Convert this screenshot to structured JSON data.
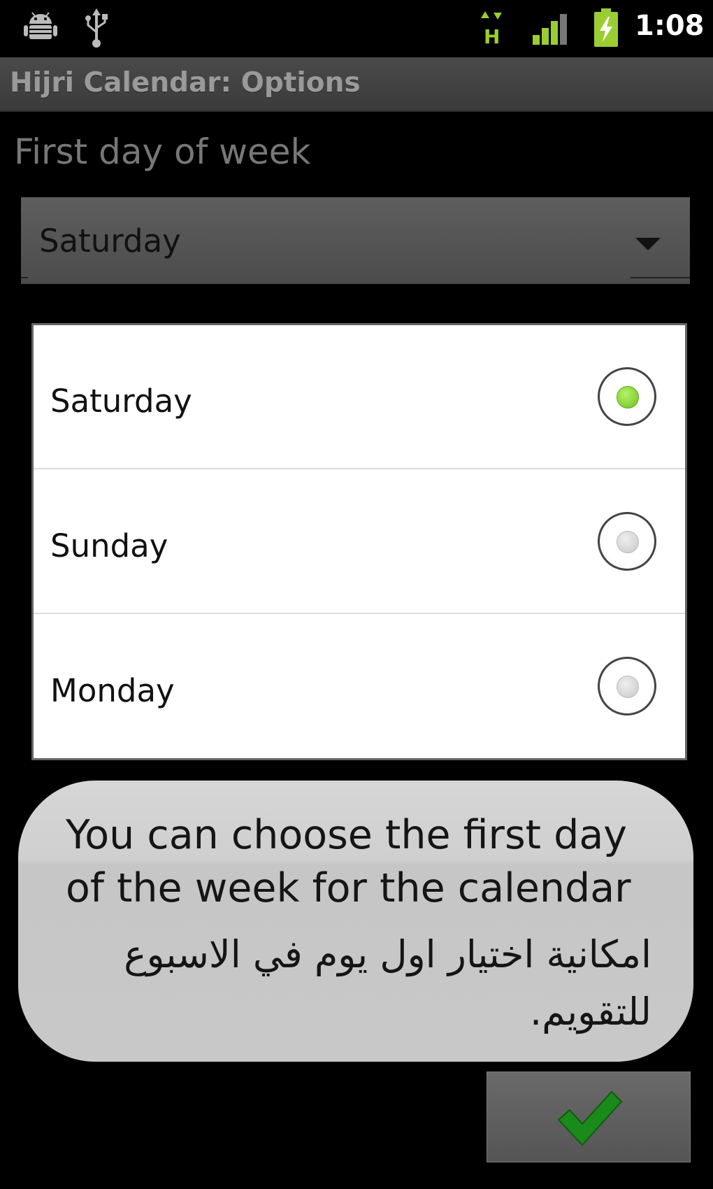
{
  "status_bar": {
    "icons": [
      "android-debug-icon",
      "usb-icon",
      "hspa-data-icon",
      "signal-icon",
      "battery-charging-icon"
    ],
    "network_type": "H",
    "time": "1:08"
  },
  "title_bar": {
    "title": "Hijri Calendar: Options"
  },
  "preference": {
    "label": "First day of week",
    "selected_value": "Saturday"
  },
  "options": [
    {
      "label": "Saturday",
      "checked": true
    },
    {
      "label": "Sunday",
      "checked": false
    },
    {
      "label": "Monday",
      "checked": false
    }
  ],
  "toast": {
    "english": "You can choose the first day of the week for the calendar",
    "arabic": "امكانية اختيار اول يوم في الاسبوع للتقويم."
  },
  "ok_button": {
    "icon": "checkmark-icon"
  },
  "colors": {
    "radio_checked": "#6cc21c",
    "checkmark": "#1a8a1a",
    "accent_status": "#9acd32"
  }
}
